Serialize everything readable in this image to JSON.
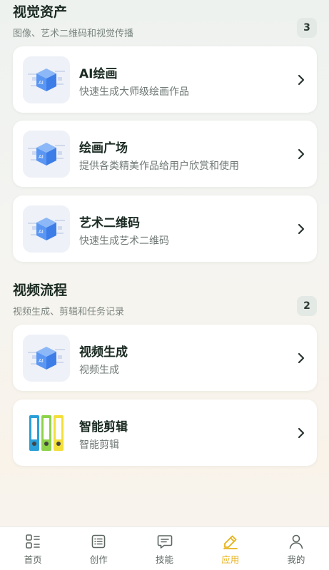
{
  "sections": [
    {
      "title": "视觉资产",
      "subtitle": "图像、艺术二维码和视觉传播",
      "count": "3",
      "items": [
        {
          "title": "AI绘画",
          "desc": "快速生成大师级绘画作品",
          "icon": "ai-cube-icon"
        },
        {
          "title": "绘画广场",
          "desc": "提供各类精美作品给用户欣赏和使用",
          "icon": "ai-cube-icon"
        },
        {
          "title": "艺术二维码",
          "desc": "快速生成艺术二维码",
          "icon": "ai-cube-icon"
        }
      ]
    },
    {
      "title": "视频流程",
      "subtitle": "视频生成、剪辑和任务记录",
      "count": "2",
      "items": [
        {
          "title": "视频生成",
          "desc": "视频生成",
          "icon": "ai-cube-icon"
        },
        {
          "title": "智能剪辑",
          "desc": "智能剪辑",
          "icon": "binders-icon"
        }
      ]
    }
  ],
  "tabbar": [
    {
      "label": "首页",
      "icon": "grid-list-icon"
    },
    {
      "label": "创作",
      "icon": "list-icon"
    },
    {
      "label": "技能",
      "icon": "chat-icon"
    },
    {
      "label": "应用",
      "icon": "edit-pen-icon",
      "active": true
    },
    {
      "label": "我的",
      "icon": "user-icon"
    }
  ],
  "colors": {
    "accent": "#e7b219",
    "text": "#1b2b23",
    "muted": "#7b8580"
  }
}
